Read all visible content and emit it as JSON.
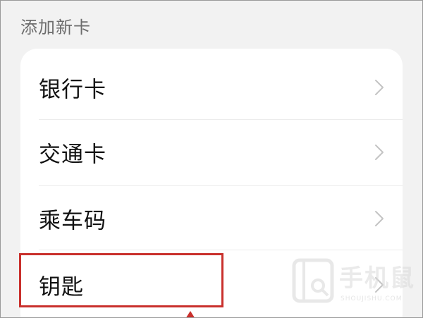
{
  "section": {
    "title": "添加新卡"
  },
  "card_types": [
    {
      "label": "银行卡",
      "icon": "chevron-right-icon"
    },
    {
      "label": "交通卡",
      "icon": "chevron-right-icon"
    },
    {
      "label": "乘车码",
      "icon": "chevron-right-icon"
    },
    {
      "label": "钥匙",
      "icon": "chevron-right-icon"
    }
  ],
  "watermark": {
    "name": "手机鼠",
    "domain": "SHOUJISHU.COM"
  },
  "colors": {
    "background": "#f2f2f2",
    "card": "#ffffff",
    "highlight": "#c9302c",
    "section_title": "#6d6d6d"
  }
}
